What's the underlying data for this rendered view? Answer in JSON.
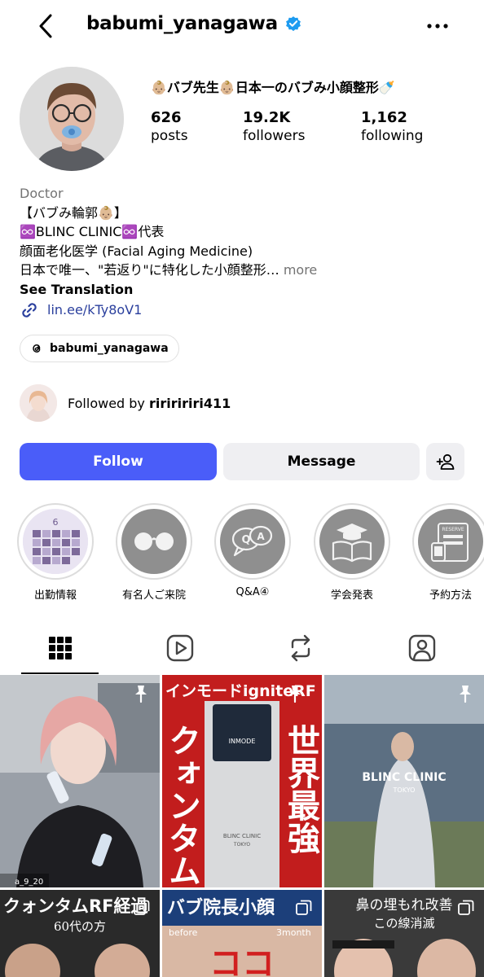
{
  "header": {
    "username": "babumi_yanagawa",
    "back_icon": "chevron-left-icon",
    "verified_icon": "verified-badge-icon",
    "more_icon": "more-horizontal-icon"
  },
  "profile": {
    "display_name": "👶🏼バブ先生👶🏼日本一のバブみ小顔整形🍼",
    "stats": {
      "posts": {
        "value": "626",
        "label": "posts"
      },
      "followers": {
        "value": "19.2K",
        "label": "followers"
      },
      "following": {
        "value": "1,162",
        "label": "following"
      }
    },
    "category": "Doctor",
    "bio_lines": [
      "【バブみ輪郭👶🏼】",
      "♾️BLINC CLINIC♾️代表",
      "顔面老化医学 (Facial Aging Medicine)",
      "日本で唯一、\"若返り\"に特化した小顔整形…"
    ],
    "more_label": "more",
    "see_translation": "See Translation",
    "link": "lin.ee/kTy8oV1",
    "threads_handle": "babumi_yanagawa",
    "followed_by_prefix": "Followed by ",
    "followed_by_user": "ririririri411"
  },
  "actions": {
    "follow": "Follow",
    "message": "Message",
    "add_icon": "add-person-icon"
  },
  "highlights": [
    {
      "label": "出勤情報",
      "calendar_month": "6"
    },
    {
      "label": "有名人ご来院"
    },
    {
      "label": "Q&A④",
      "bubble_q": "Q",
      "bubble_a": "A"
    },
    {
      "label": "学会発表"
    },
    {
      "label": "予約方法",
      "card_text": "RESERVE"
    }
  ],
  "tabs": [
    "grid-icon",
    "reels-icon",
    "reposts-icon",
    "tagged-icon"
  ],
  "posts": [
    {
      "overlay_tag": "a_9_20"
    },
    {
      "top_text": "インモードigniteRF",
      "left_text": "クォンタム",
      "right_text": "世界最強",
      "device_brand": "INMODE",
      "clinic_brand": "BLINC CLINIC",
      "clinic_sub": "TOKYO"
    },
    {
      "brand": "BLINC CLINIC",
      "sub": "TOKYO"
    },
    {
      "line1": "クォンタムRF経過",
      "line2": "60代の方"
    },
    {
      "line1": "バブ院長小顔",
      "before": "before",
      "after": "3month",
      "big": "ココ"
    },
    {
      "line1": "鼻の埋もれ改善",
      "line2": "この線消滅"
    }
  ],
  "colors": {
    "follow_blue": "#4a5df9",
    "link_blue": "#2a3f9d",
    "verified_blue": "#1d9bf0",
    "poster_red": "#c21d1d"
  }
}
